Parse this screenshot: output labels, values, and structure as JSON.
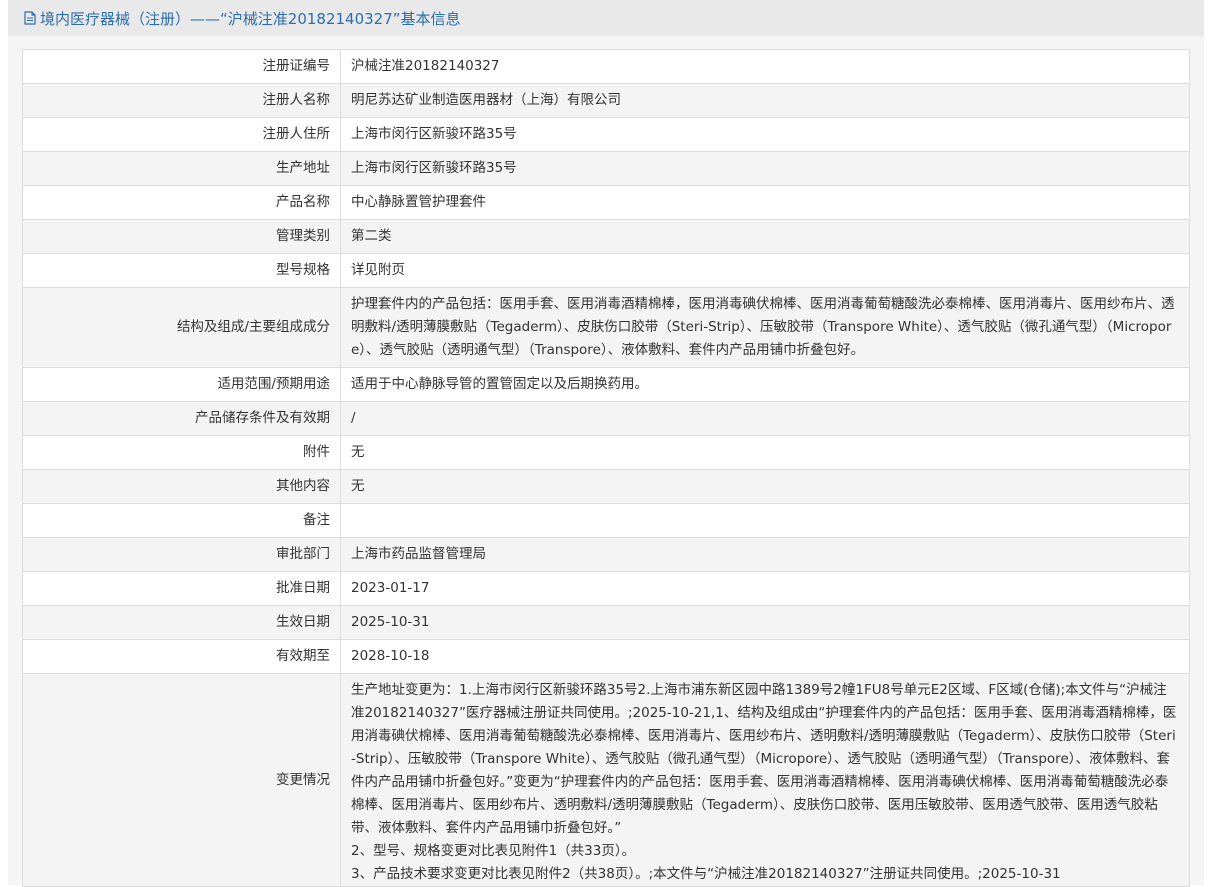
{
  "header": {
    "title": "境内医疗器械（注册）——“沪械注准20182140327”基本信息"
  },
  "rows": [
    {
      "label": "注册证编号",
      "value": "沪械注准20182140327"
    },
    {
      "label": "注册人名称",
      "value": "明尼苏达矿业制造医用器材（上海）有限公司"
    },
    {
      "label": "注册人住所",
      "value": "上海市闵行区新骏环路35号"
    },
    {
      "label": "生产地址",
      "value": "上海市闵行区新骏环路35号"
    },
    {
      "label": "产品名称",
      "value": "中心静脉置管护理套件"
    },
    {
      "label": "管理类别",
      "value": "第二类"
    },
    {
      "label": "型号规格",
      "value": "详见附页"
    },
    {
      "label": "结构及组成/主要组成成分",
      "value": "护理套件内的产品包括：医用手套、医用消毒酒精棉棒，医用消毒碘伏棉棒、医用消毒葡萄糖酸洗必泰棉棒、医用消毒片、医用纱布片、透明敷料/透明薄膜敷贴（Tegaderm）、皮肤伤口胶带（Steri-Strip）、压敏胶带（Transpore White）、透气胶贴（微孔通气型）（Micropore）、透气胶贴（透明通气型）（Transpore）、液体敷料、套件内产品用铺巾折叠包好。"
    },
    {
      "label": "适用范围/预期用途",
      "value": "适用于中心静脉导管的置管固定以及后期换药用。"
    },
    {
      "label": "产品储存条件及有效期",
      "value": "/"
    },
    {
      "label": "附件",
      "value": "无"
    },
    {
      "label": "其他内容",
      "value": "无"
    },
    {
      "label": "备注",
      "value": ""
    },
    {
      "label": "审批部门",
      "value": "上海市药品监督管理局"
    },
    {
      "label": "批准日期",
      "value": "2023-01-17"
    },
    {
      "label": "生效日期",
      "value": "2025-10-31"
    },
    {
      "label": "有效期至",
      "value": "2028-10-18"
    }
  ],
  "change": {
    "label": "变更情况",
    "lines": [
      "生产地址变更为：1.上海市闵行区新骏环路35号2.上海市浦东新区园中路1389号2幢1FU8号单元E2区域、F区域(仓储);本文件与“沪械注准20182140327”医疗器械注册证共同使用。;2025-10-21,1、结构及组成由“护理套件内的产品包括：医用手套、医用消毒酒精棉棒，医用消毒碘伏棉棒、医用消毒葡萄糖酸洗必泰棉棒、医用消毒片、医用纱布片、透明敷料/透明薄膜敷贴（Tegaderm）、皮肤伤口胶带（Steri-Strip）、压敏胶带（Transpore White）、透气胶贴（微孔通气型）（Micropore）、透气胶贴（透明通气型）（Transpore）、液体敷料、套件内产品用铺巾折叠包好。”变更为“护理套件内的产品包括：医用手套、医用消毒酒精棉棒、医用消毒碘伏棉棒、医用消毒葡萄糖酸洗必泰棉棒、医用消毒片、医用纱布片、透明敷料/透明薄膜敷贴（Tegaderm）、皮肤伤口胶带、医用压敏胶带、医用透气胶带、医用透气胶粘带、液体敷料、套件内产品用铺巾折叠包好。”",
      "2、型号、规格变更对比表见附件1（共33页）。",
      "3、产品技术要求变更对比表见附件2（共38页）。;本文件与“沪械注准20182140327”注册证共同使用。;2025-10-31"
    ]
  },
  "colors": {
    "header_bg": "#e9e9e9",
    "title_color": "#2b6db0",
    "border": "#dddddd",
    "stripe": "#f4f4f4"
  },
  "icons": {
    "header_icon": "document-icon"
  }
}
